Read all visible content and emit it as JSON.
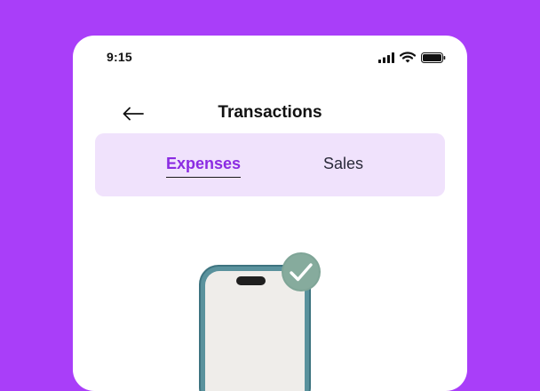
{
  "status_bar": {
    "time": "9:15",
    "icons": [
      "signal-icon",
      "wifi-icon",
      "battery-icon"
    ]
  },
  "header": {
    "back_icon": "back-arrow-icon",
    "title": "Transactions"
  },
  "tabs": [
    {
      "label": "Expenses",
      "active": true
    },
    {
      "label": "Sales",
      "active": false
    }
  ],
  "illustration": {
    "name": "phone-with-checkmark",
    "badge_icon": "checkmark-icon"
  },
  "colors": {
    "background": "#A93EF9",
    "tab_bg": "#F0E2FC",
    "active_tab": "#8B2BE2",
    "phone_frame": "#4F8793",
    "badge": "#7FA597"
  }
}
